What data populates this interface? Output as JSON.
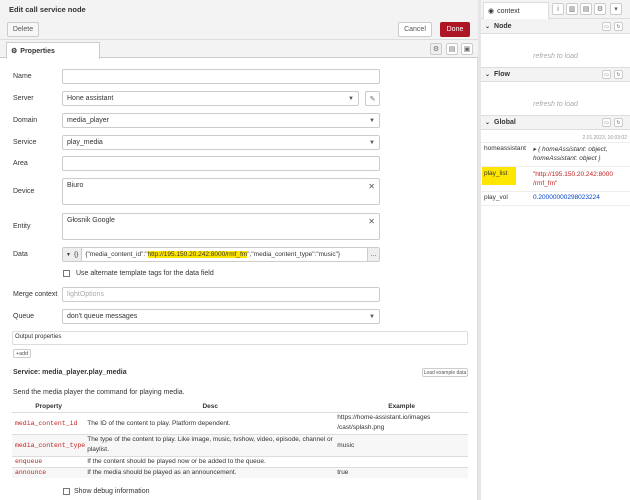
{
  "dialog": {
    "title": "Edit call service node",
    "delete_label": "Delete",
    "cancel_label": "Cancel",
    "done_label": "Done",
    "tab_label": "Properties"
  },
  "form": {
    "name_label": "Name",
    "server_label": "Server",
    "server_value": "Hone assistant",
    "domain_label": "Domain",
    "domain_value": "media_player",
    "service_label": "Service",
    "service_value": "play_media",
    "area_label": "Area",
    "device_label": "Device",
    "device_value": "Biuro",
    "entity_label": "Entity",
    "entity_value": "Głosnik Google",
    "data_label": "Data",
    "data_type": "{}",
    "data_pre": "{\"media_content_id\":\"",
    "data_url": "http://195.150.20.242:8000/rmf_fm",
    "data_post": "\",\"media_content_type\":\"music\"}",
    "alt_tags_label": "Use alternate template tags for the data field",
    "merge_label": "Merge context",
    "merge_placeholder": "lightOptions",
    "queue_label": "Queue",
    "queue_value": "don't queue messages",
    "output_label": "Output properties",
    "add_label": "add"
  },
  "service_doc": {
    "title": "Service: media_player.play_media",
    "load_example": "Load example data",
    "description": "Send the media player the command for playing media.",
    "columns": [
      "Property",
      "Desc",
      "Example"
    ],
    "rows": [
      {
        "prop": "media_content_id",
        "desc": "The ID of the content to play. Platform dependent.",
        "example": "https://home-assistant.io/images /cast/splash.png"
      },
      {
        "prop": "media_content_type",
        "desc": "The type of the content to play. Like image, music, tvshow, video, episode, channel or playlist.",
        "example": "music"
      },
      {
        "prop": "enqueue",
        "desc": "If the content should be played now or be added to the queue.",
        "example": ""
      },
      {
        "prop": "announce",
        "desc": "If the media should be played as an announcement.",
        "example": "true"
      }
    ],
    "debug_label": "Show debug information"
  },
  "sidebar": {
    "tab_label": "context",
    "node_section": "Node",
    "flow_section": "Flow",
    "global_section": "Global",
    "refresh_label": "refresh to load",
    "timestamp": "2.01.2023, 16:03:02",
    "entries": [
      {
        "key": "homeassistant",
        "value_line1": "▸ { homeAssistant: object,",
        "value_line2": "homeAssistant: object }"
      },
      {
        "key": "play_list",
        "value_line1": "\"http://195.150.20.242:8000",
        "value_line2": "/rmf_fm\""
      },
      {
        "key": "play_vol",
        "value_line1": "0.20000000298023224",
        "value_line2": ""
      }
    ]
  },
  "colors": {
    "done": "#ad1625",
    "highlight": "#ffe600",
    "prop_red": "#c02020",
    "link_blue": "#0044cc"
  }
}
